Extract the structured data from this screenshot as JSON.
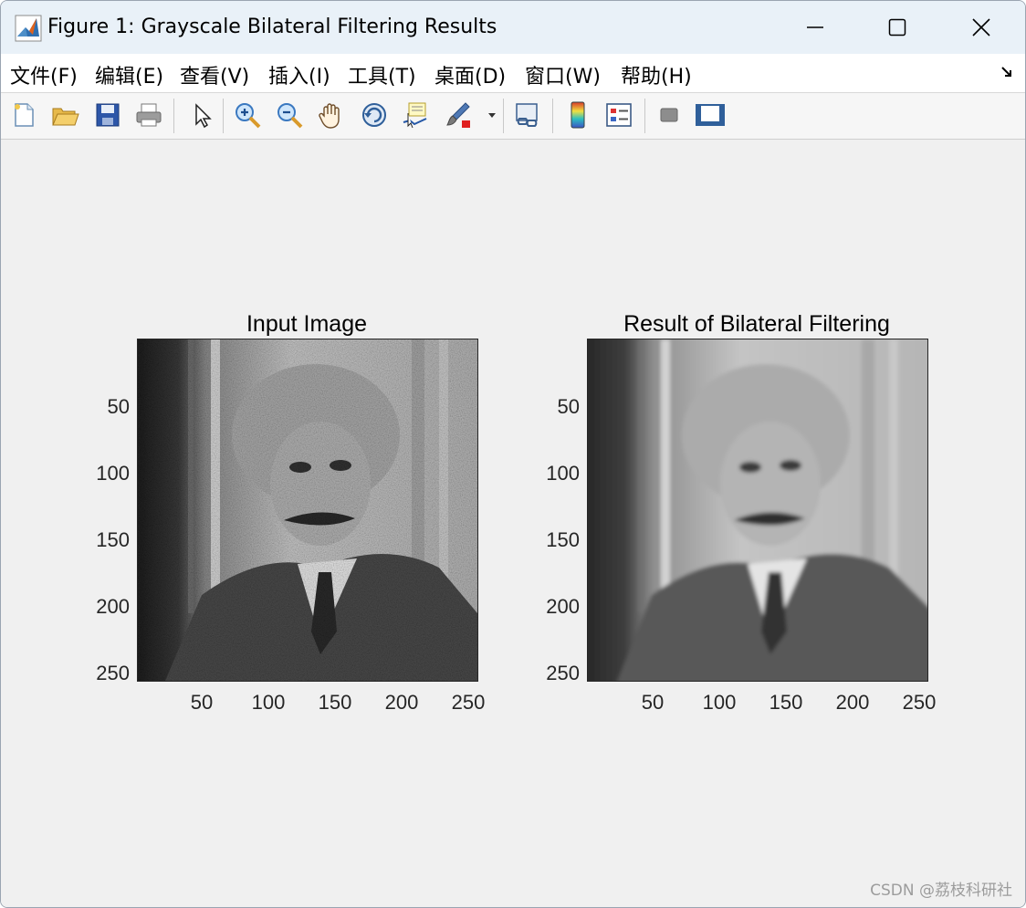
{
  "window": {
    "title": "Figure 1: Grayscale Bilateral Filtering Results",
    "controls": {
      "minimize": "minimize",
      "maximize": "maximize",
      "close": "close"
    }
  },
  "menu": {
    "items": [
      {
        "label": "文件(F)",
        "name": "file"
      },
      {
        "label": "编辑(E)",
        "name": "edit"
      },
      {
        "label": "查看(V)",
        "name": "view"
      },
      {
        "label": "插入(I)",
        "name": "insert"
      },
      {
        "label": "工具(T)",
        "name": "tools"
      },
      {
        "label": "桌面(D)",
        "name": "desktop"
      },
      {
        "label": "窗口(W)",
        "name": "window"
      },
      {
        "label": "帮助(H)",
        "name": "help"
      }
    ]
  },
  "toolbar": {
    "icons": [
      "new-figure-icon",
      "open-file-icon",
      "save-icon",
      "print-icon",
      "select-pointer-icon",
      "zoom-in-icon",
      "zoom-out-icon",
      "pan-hand-icon",
      "rotate-3d-icon",
      "data-cursor-icon",
      "brush-icon",
      "link-plot-icon",
      "colorbar-icon",
      "legend-icon",
      "hide-plot-tools-icon",
      "show-plot-tools-icon"
    ]
  },
  "axes": [
    {
      "title": "Input Image",
      "image": "einstein-noisy-grayscale",
      "yticks": [
        "50",
        "100",
        "150",
        "200",
        "250"
      ],
      "xticks": [
        "50",
        "100",
        "150",
        "200",
        "250"
      ]
    },
    {
      "title": "Result of Bilateral Filtering",
      "image": "einstein-smoothed-grayscale",
      "yticks": [
        "50",
        "100",
        "150",
        "200",
        "250"
      ],
      "xticks": [
        "50",
        "100",
        "150",
        "200",
        "250"
      ]
    }
  ],
  "watermark": "CSDN @荔枝科研社"
}
